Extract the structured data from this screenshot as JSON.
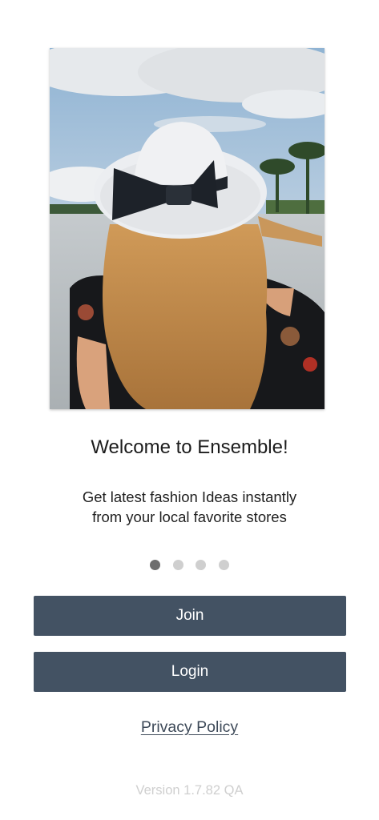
{
  "onboarding": {
    "hero_image": {
      "description_icon": "fashion-photo",
      "colors": {
        "sky": "#9bbbd8",
        "water": "#c8cdd0",
        "hat": "#ecedf0",
        "bow": "#20252c",
        "hair": "#c08a4b",
        "dress": "#17181b"
      }
    },
    "title": "Welcome to Ensemble!",
    "subtitle_lines": [
      "Get latest fashion Ideas instantly",
      "from your local favorite stores"
    ],
    "pager": {
      "count": 4,
      "active_index": 0
    },
    "buttons": {
      "join_label": "Join",
      "login_label": "Login"
    },
    "privacy_label": "Privacy Policy",
    "version_text": "Version 1.7.82 QA"
  },
  "colors": {
    "button_bg": "#435263",
    "dot_active": "#6e6e6e",
    "dot_inactive": "#cfcfcf",
    "version_text": "#cfcfcf"
  }
}
